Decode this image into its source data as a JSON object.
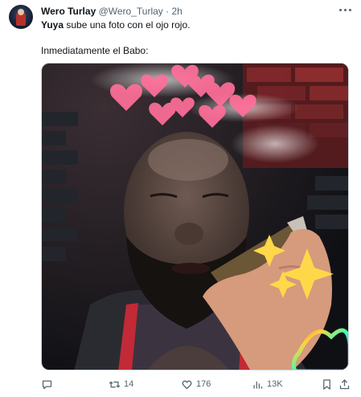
{
  "tweet": {
    "author_name": "Wero Turlay",
    "handle": "@Wero_Turlay",
    "separator": "·",
    "time": "2h",
    "line1_bold": "Yuya",
    "line1_rest": " sube una foto con el ojo rojo.",
    "line2": "Inmediatamente el Babo:"
  },
  "icons": {
    "more": "more-horizontal-icon",
    "reply": "reply-icon",
    "retweet": "retweet-icon",
    "like": "heart-icon",
    "views": "views-chart-icon",
    "bookmark": "bookmark-icon",
    "share": "share-icon"
  },
  "actions": {
    "retweets": "14",
    "likes": "176",
    "views": "13K"
  }
}
